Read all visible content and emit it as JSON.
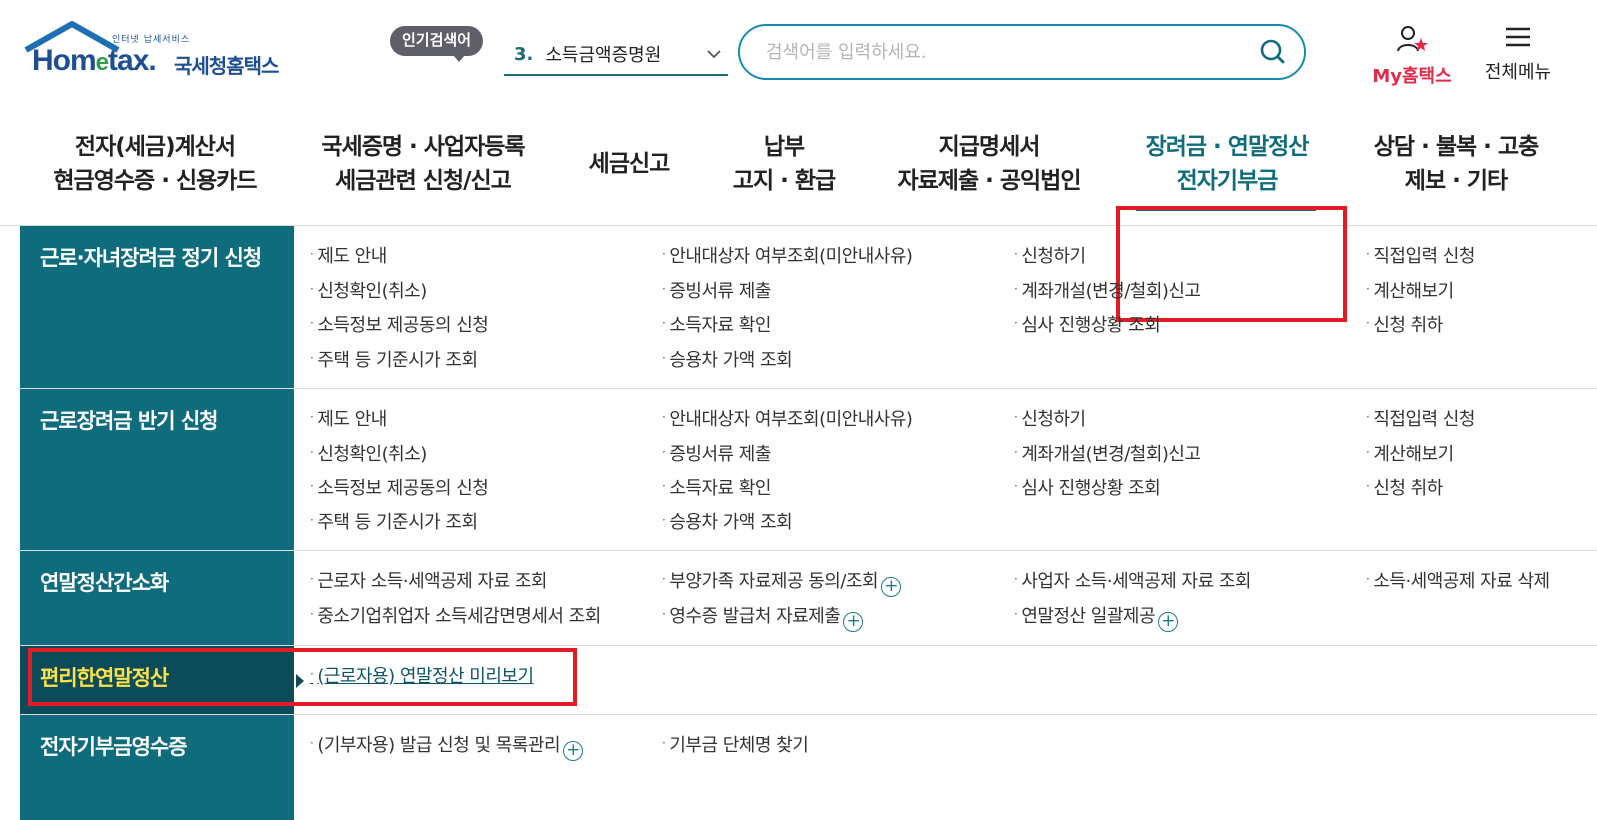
{
  "logo": {
    "small": "인터넷 납세서비스",
    "home": "Hom",
    "e": "e",
    "tax": "tax.",
    "name": "국세청홈택스"
  },
  "header": {
    "popular_badge": "인기검색어",
    "popular_rank": "3.",
    "popular_keyword": "소득금액증명원",
    "search_placeholder": "검색어를 입력하세요.",
    "my_label": "My홈택스",
    "all_menu_label": "전체메뉴"
  },
  "gnb": [
    {
      "l1": "전자(세금)계산서",
      "l2": "현금영수증 · 신용카드"
    },
    {
      "l1": "국세증명 · 사업자등록",
      "l2": "세금관련 신청/신고"
    },
    {
      "l1": "세금신고",
      "l2": ""
    },
    {
      "l1": "납부",
      "l2": "고지 · 환급"
    },
    {
      "l1": "지급명세서",
      "l2": "자료제출 · 공익법인"
    },
    {
      "l1": "장려금 · 연말정산",
      "l2": "전자기부금"
    },
    {
      "l1": "상담 · 불복 · 고충",
      "l2": "제보 · 기타"
    }
  ],
  "menu": [
    {
      "title": "근로·자녀장려금 정기 신청",
      "links": [
        "제도 안내",
        "안내대상자 여부조회(미안내사유)",
        "신청하기",
        "직접입력 신청",
        "신청확인(취소)",
        "증빙서류 제출",
        "계좌개설(변경/철회)신고",
        "계산해보기",
        "소득정보 제공동의 신청",
        "소득자료 확인",
        "심사 진행상황 조회",
        "신청 취하",
        "주택 등 기준시가 조회",
        "승용차 가액 조회"
      ]
    },
    {
      "title": "근로장려금 반기 신청",
      "links": [
        "제도 안내",
        "안내대상자 여부조회(미안내사유)",
        "신청하기",
        "직접입력 신청",
        "신청확인(취소)",
        "증빙서류 제출",
        "계좌개설(변경/철회)신고",
        "계산해보기",
        "소득정보 제공동의 신청",
        "소득자료 확인",
        "심사 진행상황 조회",
        "신청 취하",
        "주택 등 기준시가 조회",
        "승용차 가액 조회"
      ]
    },
    {
      "title": "연말정산간소화",
      "links": [
        "근로자 소득·세액공제 자료 조회",
        "부양가족 자료제공 동의/조회",
        "사업자 소득·세액공제 자료 조회",
        "소득·세액공제 자료 삭제",
        "중소기업취업자 소득세감면명세서 조회",
        "영수증 발급처 자료제출",
        "연말정산 일괄제공"
      ]
    },
    {
      "title": "편리한연말정산",
      "links": [
        "(근로자용) 연말정산 미리보기"
      ]
    },
    {
      "title": "전자기부금영수증",
      "links": [
        "(기부자용) 발급 신청 및 목록관리",
        "기부금 단체명 찾기"
      ]
    }
  ]
}
